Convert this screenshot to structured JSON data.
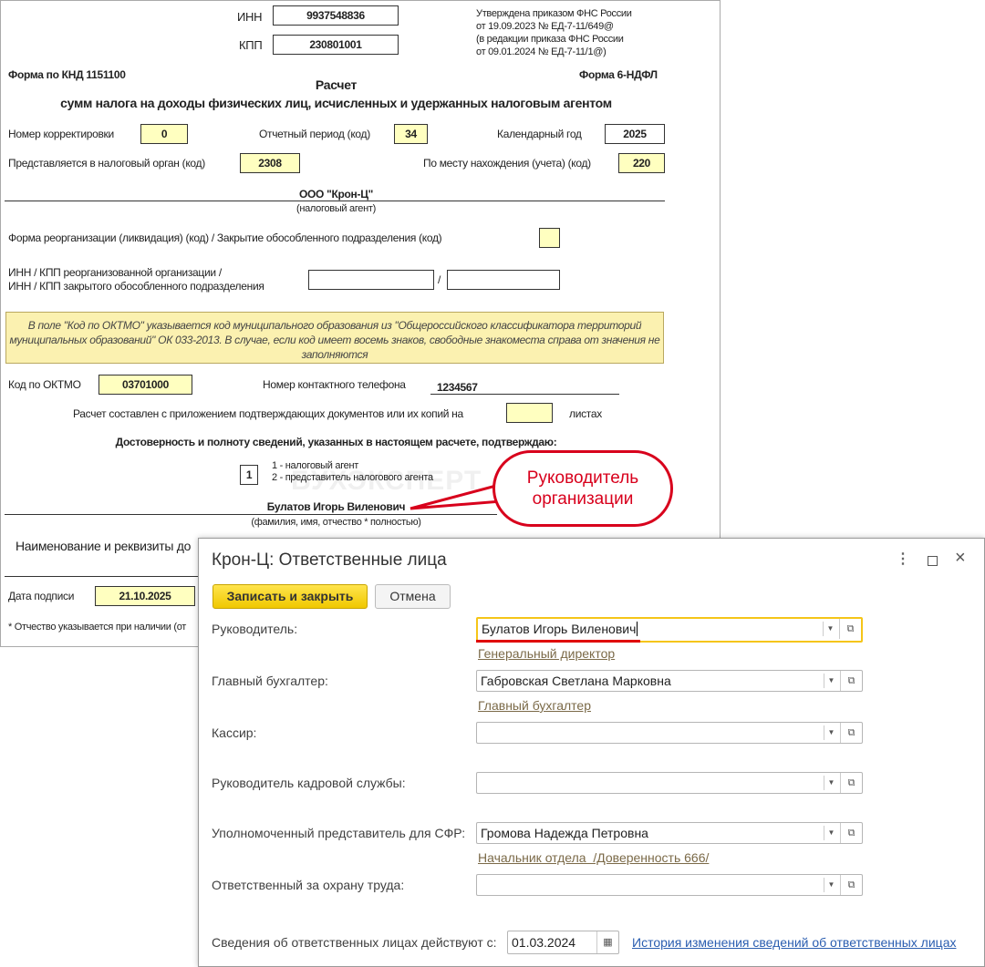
{
  "doc": {
    "inn_label": "ИНН",
    "inn": "9937548836",
    "kpp_label": "КПП",
    "kpp": "230801001",
    "approved": [
      "Утверждена приказом ФНС России",
      "от 19.09.2023 № ЕД-7-11/649@",
      "(в редакции приказа ФНС России",
      "от 09.01.2024 № ЕД-7-11/1@)"
    ],
    "knd": "Форма по КНД 1151100",
    "form_name": "Форма 6-НДФЛ",
    "title": "Расчет",
    "subtitle": "сумм налога на доходы физических лиц, исчисленных и удержанных налоговым агентом",
    "corr_label": "Номер корректировки",
    "corr": "0",
    "period_label": "Отчетный период (код)",
    "period": "34",
    "year_label": "Календарный год",
    "year": "2025",
    "org_label": "Представляется в налоговый орган (код)",
    "org": "2308",
    "place_label": "По месту нахождения (учета) (код)",
    "place": "220",
    "agent": "ООО \"Крон-Ц\"",
    "agent_caption": "(налоговый агент)",
    "reorg_label": "Форма реорганизации (ликвидация) (код) / Закрытие обособленного подразделения (код)",
    "reorg_inn_label1": "ИНН / КПП реорганизованной организации /",
    "reorg_inn_label2": "ИНН / КПП закрытого обособленного подразделения",
    "slash": "/",
    "note": "В поле \"Код по ОКТМО\" указывается код муниципального образования из \"Общероссийского классификатора территорий муниципальных образований\" ОК 033-2013. В случае, если код имеет восемь знаков, свободные знакоместа справа от значения не заполняются",
    "oktmo_label": "Код по ОКТМО",
    "oktmo": "03701000",
    "phone_label": "Номер контактного телефона",
    "phone": "1234567",
    "attach_label": "Расчет составлен с приложением подтверждающих документов или их копий на",
    "sheets": "листах",
    "confirm": "Достоверность и полноту сведений, указанных в настоящем расчете, подтверждаю:",
    "signer_code": "1",
    "signer_opt1": "1 - налоговый агент",
    "signer_opt2": "2 - представитель налогового агента",
    "signer": "Булатов Игорь Виленович",
    "signer_caption": "(фамилия, имя, отчество * полностью)",
    "doc_req": "Наименование и реквизиты до",
    "date_label": "Дата подписи",
    "date": "21.10.2025",
    "footnote": "* Отчество указывается при наличии (от"
  },
  "watermark": "БУХЭКСПЕРТ",
  "callout": {
    "line1": "Руководитель",
    "line2": "организации"
  },
  "dialog": {
    "title": "Крон-Ц: Ответственные лица",
    "save": "Записать и закрыть",
    "cancel": "Отмена",
    "fields": [
      {
        "label": "Руководитель:",
        "value": "Булатов Игорь Виленович",
        "link": "Генеральный директор"
      },
      {
        "label": "Главный бухгалтер:",
        "value": "Габровская Светлана Марковна",
        "link": "Главный бухгалтер"
      },
      {
        "label": "Кассир:",
        "value": ""
      },
      {
        "label": "Руководитель кадровой службы:",
        "value": ""
      },
      {
        "label": "Уполномоченный представитель для СФР:",
        "value": "Громова Надежда Петровна",
        "link": "Начальник отдела  /Доверенность 666/"
      },
      {
        "label": "Ответственный за охрану труда:",
        "value": ""
      }
    ],
    "valid_label": "Сведения об ответственных лицах действуют с:",
    "valid_date": "01.03.2024",
    "history_link": "История изменения сведений об ответственных лицах"
  }
}
